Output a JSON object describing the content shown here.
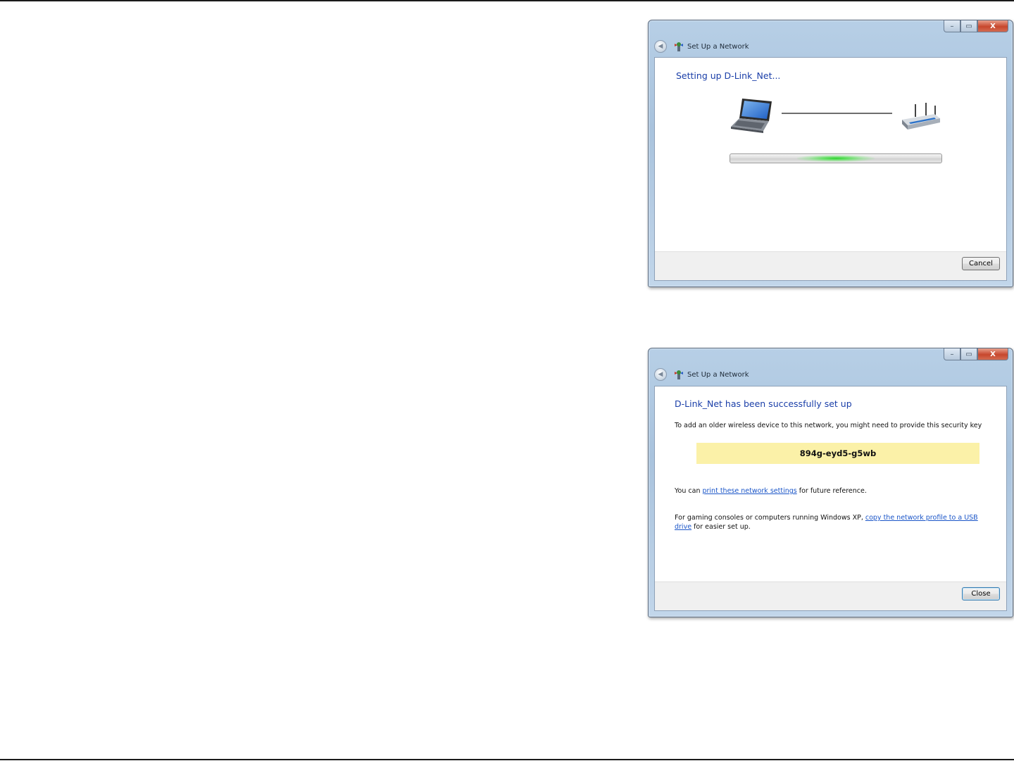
{
  "dialog_setting_up": {
    "title": "Set Up a Network",
    "heading": "Setting up D-Link_Net...",
    "progress_percent": 40,
    "cancel_label": "Cancel",
    "caption_buttons": {
      "min": "–",
      "max": "▭",
      "close": "X"
    }
  },
  "dialog_success": {
    "title": "Set Up a Network",
    "heading": "D-Link_Net has been successfully set up",
    "instruction": "To add an older wireless device to this network, you might need to provide this security key",
    "security_key": "894g-eyd5-g5wb",
    "print_prefix": "You can ",
    "print_link": "print these network settings",
    "print_suffix": " for future reference.",
    "usb_prefix": "For gaming consoles or computers running Windows XP, ",
    "usb_link": "copy the network profile to a USB drive",
    "usb_suffix": " for easier set up.",
    "close_label": "Close",
    "caption_buttons": {
      "min": "–",
      "max": "▭",
      "close": "X"
    }
  },
  "icons": {
    "back": "back-arrow-icon",
    "network": "network-setup-icon",
    "laptop": "laptop-icon",
    "router": "wireless-router-icon"
  },
  "colors": {
    "heading_blue": "#1a3ea8",
    "link_blue": "#1a55c8",
    "key_highlight": "#fbf1a8",
    "progress_green": "#2ed12e"
  }
}
